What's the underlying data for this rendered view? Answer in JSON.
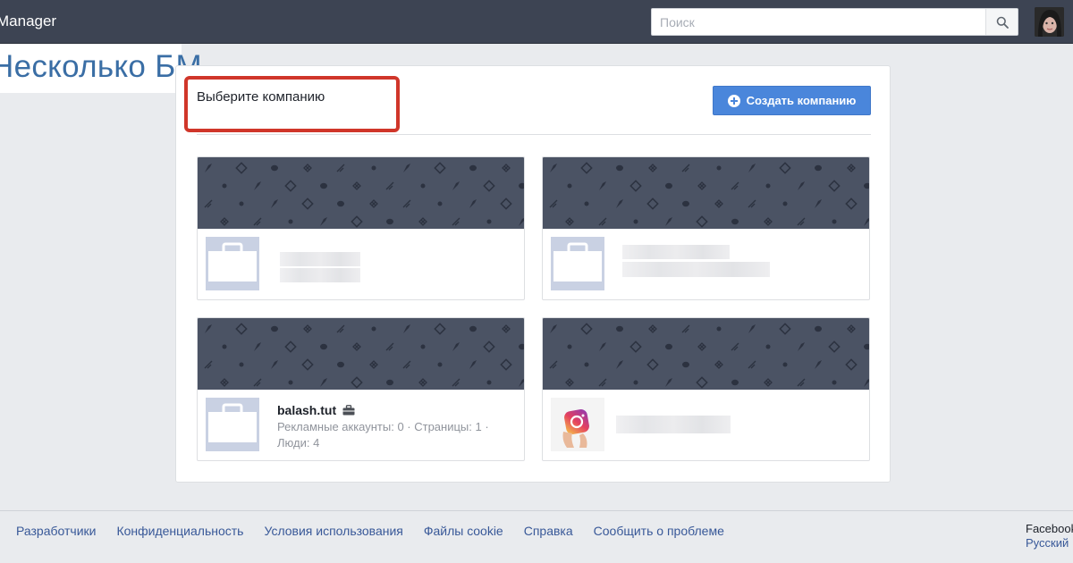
{
  "header": {
    "app_title": "Manager",
    "search_placeholder": "Поиск"
  },
  "overlay": {
    "text": "Несколько БМ"
  },
  "panel": {
    "title": "Выберите компанию",
    "create_button": "Создать компанию"
  },
  "businesses": [
    {
      "name": "",
      "meta": ""
    },
    {
      "name": "",
      "meta": ""
    },
    {
      "name": "balash.tut",
      "meta": "Рекламные аккаунты: 0 · Страницы: 1 · Люди: 4"
    },
    {
      "name": "",
      "meta": ""
    }
  ],
  "footer": {
    "links": [
      "Разработчики",
      "Конфиденциальность",
      "Условия использования",
      "Файлы cookie",
      "Справка",
      "Сообщить о проблеме"
    ],
    "brand": "Facebook",
    "language": "Русский"
  },
  "colors": {
    "topbar": "#3d4453",
    "accent": "#4a86db",
    "highlight": "#d0362a",
    "banner": "#4b5364",
    "link": "#385898"
  }
}
